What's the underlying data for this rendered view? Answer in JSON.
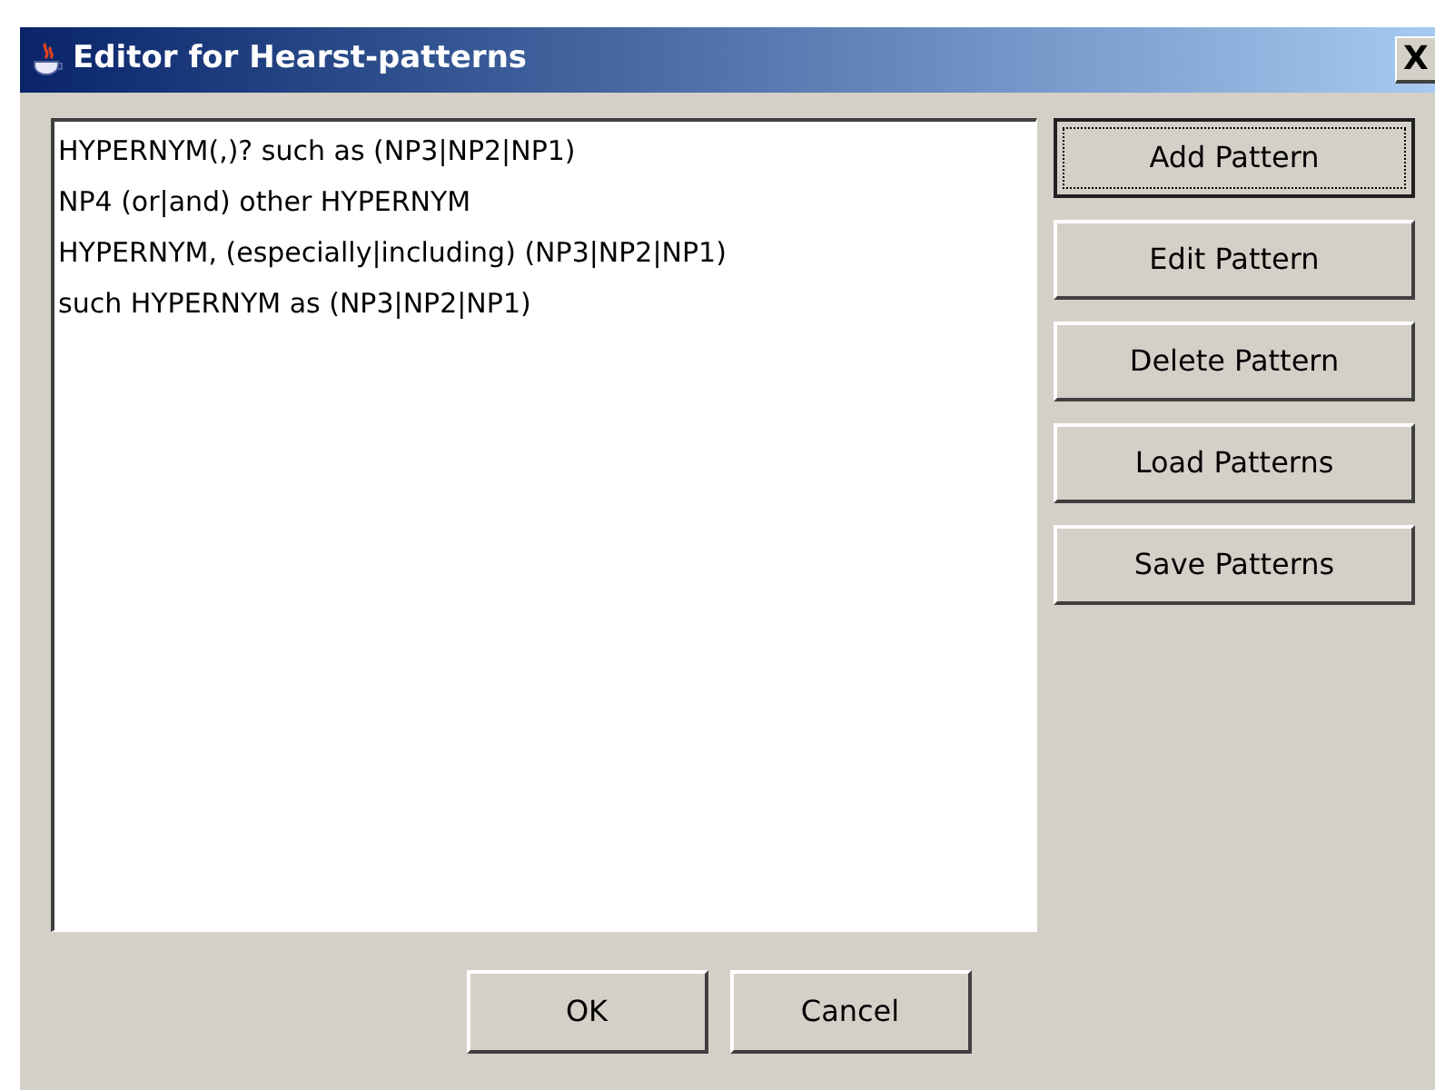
{
  "window": {
    "title": "Editor for Hearst-patterns",
    "close": "X"
  },
  "patterns": [
    "HYPERNYM(,)? such as (NP3|NP2|NP1)",
    "NP4 (or|and) other HYPERNYM",
    "HYPERNYM, (especially|including) (NP3|NP2|NP1)",
    "such HYPERNYM as (NP3|NP2|NP1)"
  ],
  "side_buttons": [
    {
      "label": "Add Pattern",
      "focused": true
    },
    {
      "label": "Edit Pattern",
      "focused": false
    },
    {
      "label": "Delete Pattern",
      "focused": false
    },
    {
      "label": "Load Patterns",
      "focused": false
    },
    {
      "label": "Save Patterns",
      "focused": false
    }
  ],
  "dialog_buttons": [
    "OK",
    "Cancel"
  ]
}
